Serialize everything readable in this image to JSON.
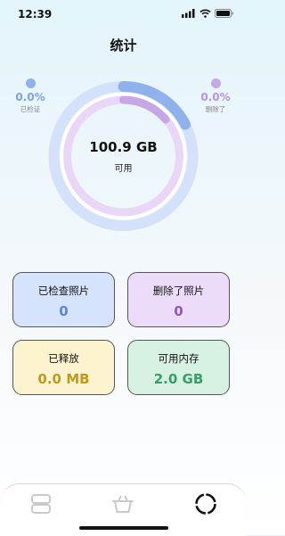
{
  "status_bar": {
    "time": "12:39"
  },
  "header": {
    "title": "统计"
  },
  "legend": {
    "verified": {
      "percent": "0.0%",
      "label": "已检证",
      "color": "#8fb2ec"
    },
    "deleted": {
      "percent": "0.0%",
      "label": "删除了",
      "color": "#c6a6e4"
    }
  },
  "storage": {
    "free_value": "100.9 GB",
    "free_label": "可用"
  },
  "cards": [
    {
      "title": "已检查照片",
      "value": "0",
      "bg": "#d6e3fd",
      "value_color": "#5a86d4"
    },
    {
      "title": "删除了照片",
      "value": "0",
      "bg": "#ecdcfa",
      "value_color": "#8a5cb6"
    },
    {
      "title": "已释放",
      "value": "0.0 MB",
      "bg": "#fdf4cf",
      "value_color": "#bf9a19"
    },
    {
      "title": "可用内存",
      "value": "2.0 GB",
      "bg": "#d7f2e3",
      "value_color": "#3a9c6a"
    }
  ],
  "tab_bar": {
    "items": [
      {
        "icon": "gallery-icon",
        "active": false
      },
      {
        "icon": "basket-icon",
        "active": false
      },
      {
        "icon": "stats-ring-icon",
        "active": true
      }
    ]
  }
}
